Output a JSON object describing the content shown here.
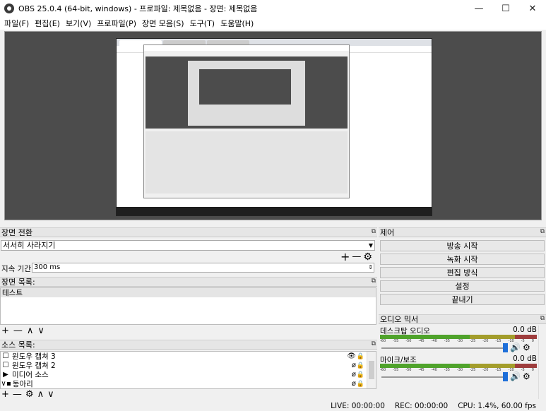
{
  "window": {
    "title": "OBS 25.0.4 (64-bit, windows) - 프로파일: 제목없음 - 장면: 제목없음",
    "minimize": "—",
    "maximize": "☐",
    "close": "✕"
  },
  "menu": [
    "파일(F)",
    "편집(E)",
    "보기(V)",
    "프로파일(P)",
    "장면 모음(S)",
    "도구(T)",
    "도움말(H)"
  ],
  "scene_transition": {
    "title": "장면 전환",
    "selected": "서서히 사라지기",
    "duration_label": "지속 기간",
    "duration_value": "300 ms",
    "add": "+",
    "remove": "—",
    "settings": "⚙"
  },
  "scenes": {
    "title": "장면 목록:",
    "items": [
      "테스트"
    ],
    "add": "+",
    "remove": "—",
    "up": "∧",
    "down": "∨"
  },
  "sources": {
    "title": "소스 목록:",
    "items": [
      {
        "icon": "☐",
        "name": "윈도우 캡쳐 3",
        "visible": "👁"
      },
      {
        "icon": "☐",
        "name": "윈도우 캡쳐 2",
        "visible": "ø"
      },
      {
        "icon": "▶",
        "name": "미디어 소스",
        "visible": "ø"
      },
      {
        "icon": "▪",
        "name": "동아리",
        "visible": "ø"
      }
    ],
    "group_toggle": "∨",
    "lock": "🔒",
    "add": "+",
    "remove": "—",
    "settings": "⚙",
    "up": "∧",
    "down": "∨"
  },
  "controls": {
    "title": "제어",
    "buttons": [
      "방송 시작",
      "녹화 시작",
      "편집 방식",
      "설정",
      "끝내기"
    ]
  },
  "mixer": {
    "title": "오디오 믹서",
    "tick_labels": [
      "-60",
      "-55",
      "-50",
      "-45",
      "-40",
      "-35",
      "-30",
      "-25",
      "-20",
      "-15",
      "-10",
      "-5",
      "0"
    ],
    "channels": [
      {
        "name": "데스크탑 오디오",
        "db": "0.0 dB",
        "volume": 1.0
      },
      {
        "name": "마이크/보조",
        "db": "0.0 dB",
        "volume": 1.0
      }
    ],
    "speaker": "🔊",
    "gear": "⚙"
  },
  "float_icon": "⧉",
  "status": {
    "live": "LIVE: 00:00:00",
    "rec": "REC: 00:00:00",
    "cpu": "CPU: 1.4%, 60.00 fps"
  }
}
